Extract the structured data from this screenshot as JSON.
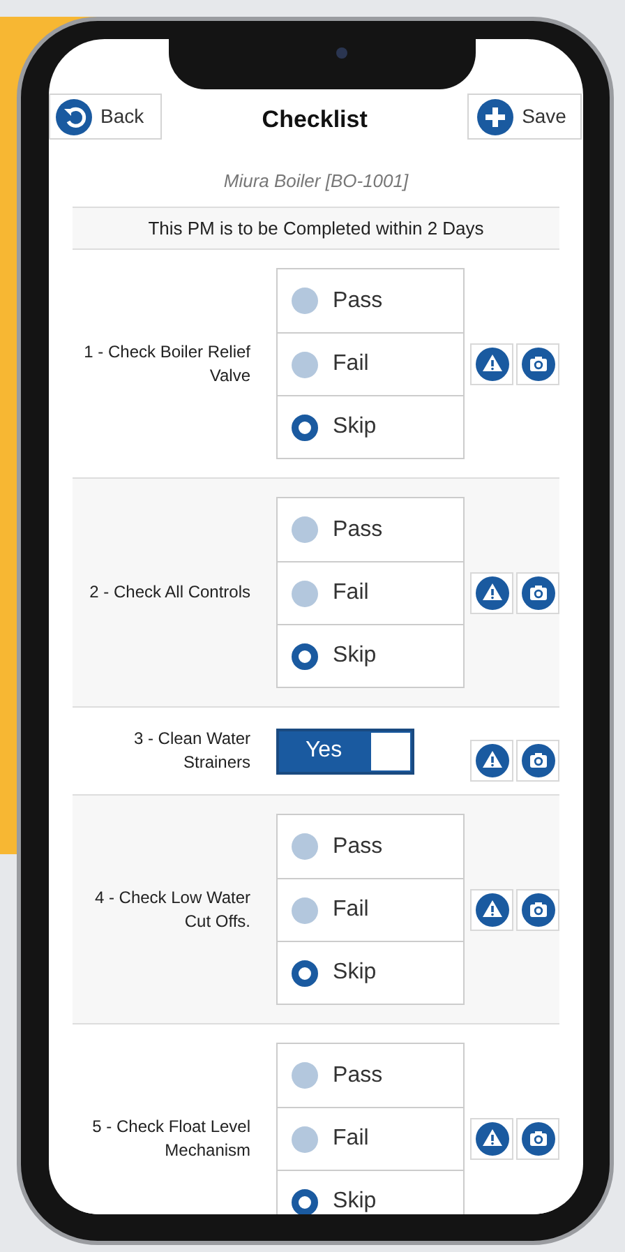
{
  "header": {
    "back": "Back",
    "title": "Checklist",
    "save": "Save"
  },
  "asset": "Miura Boiler [BO-1001]",
  "notice": "This PM is to be Completed within 2 Days",
  "items": [
    {
      "kind": "radio",
      "label": "1 - Check Boiler Relief Valve",
      "options": [
        {
          "label": "Pass",
          "selected": false
        },
        {
          "label": "Fail",
          "selected": false
        },
        {
          "label": "Skip",
          "selected": true
        }
      ]
    },
    {
      "kind": "radio",
      "label": "2 - Check All Controls",
      "options": [
        {
          "label": "Pass",
          "selected": false
        },
        {
          "label": "Fail",
          "selected": false
        },
        {
          "label": "Skip",
          "selected": true
        }
      ]
    },
    {
      "kind": "toggle",
      "label": "3 - Clean Water Strainers",
      "toggle_label": "Yes",
      "on": true
    },
    {
      "kind": "radio",
      "label": "4 - Check Low Water Cut Offs.",
      "options": [
        {
          "label": "Pass",
          "selected": false
        },
        {
          "label": "Fail",
          "selected": false
        },
        {
          "label": "Skip",
          "selected": true
        }
      ]
    },
    {
      "kind": "radio",
      "label": "5 - Check Float Level Mechanism",
      "options": [
        {
          "label": "Pass",
          "selected": false
        },
        {
          "label": "Fail",
          "selected": false
        },
        {
          "label": "Skip",
          "selected": true
        }
      ]
    }
  ]
}
